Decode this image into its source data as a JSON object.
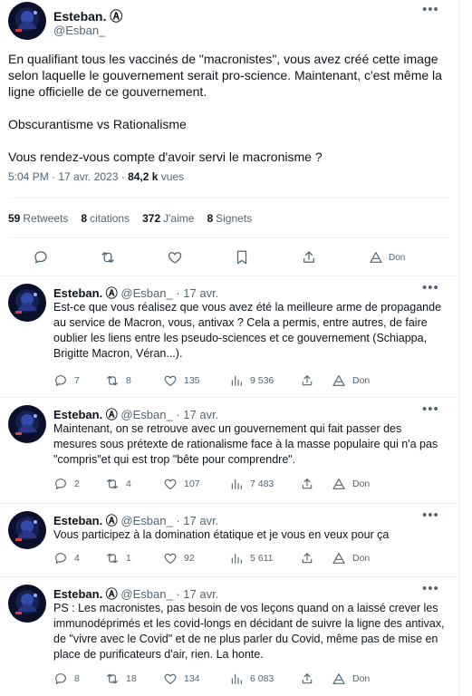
{
  "tweet": {
    "author_name": "Esteban. Ⓐ",
    "author_handle": "@Esban_",
    "body": "En qualifiant tous les vaccinés de \"macronistes\", vous avez créé cette image selon laquelle le gouvernement serait pro-science. Maintenant, c'est même la ligne officielle de ce gouvernement.\n\nObscurantisme vs Rationalisme\n\nVous rendez-vous compte d'avoir servi le macronisme ?",
    "time": "5:04 PM · 17 avr. 2023 · ",
    "views_count": "84,2 k",
    "views_label": " vues",
    "stats": {
      "retweets_count": "59",
      "retweets_label": "Retweets",
      "quotes_count": "8",
      "quotes_label": "citations",
      "likes_count": "372",
      "likes_label": "J'aime",
      "bookmarks_count": "8",
      "bookmarks_label": "Signets"
    },
    "donate_label": "Don"
  },
  "replies": [
    {
      "name": "Esteban. Ⓐ",
      "handle": "@Esban_ · 17 avr.",
      "text": "Est-ce que vous réalisez que vous avez été la meilleure arme de propagande au service de Macron, vous, antivax ? Cela a permis, entre autres, de faire oublier les liens entre les pseudo-sciences et ce gouvernement (Schiappa, Brigitte Macron, Véran...).",
      "replies": "7",
      "retweets": "8",
      "likes": "135",
      "views": "9 536",
      "donate": "Don"
    },
    {
      "name": "Esteban. Ⓐ",
      "handle": "@Esban_ · 17 avr.",
      "text": "Maintenant, on se retrouve avec un gouvernement qui fait passer des mesures sous prétexte de rationalisme face à la masse populaire qui n'a pas \"compris\"et qui est trop \"bête pour comprendre\".",
      "replies": "2",
      "retweets": "4",
      "likes": "107",
      "views": "7 483",
      "donate": "Don"
    },
    {
      "name": "Esteban. Ⓐ",
      "handle": "@Esban_ · 17 avr.",
      "text": "Vous participez à la domination étatique et je vous en veux pour ça",
      "replies": "4",
      "retweets": "1",
      "likes": "92",
      "views": "5 611",
      "donate": "Don"
    },
    {
      "name": "Esteban. Ⓐ",
      "handle": "@Esban_ · 17 avr.",
      "text": "PS : Les macronistes, pas besoin de vos leçons quand on a laissé crever les immunodéprimés et les covid-longs en décidant de suivre la ligne des antivax, de \"vivre avec le Covid\" et de ne plus parler du Covid, même pas de mise en place de purificateurs d'air, rien. La honte.",
      "replies": "8",
      "retweets": "18",
      "likes": "134",
      "views": "6 083",
      "donate": "Don"
    }
  ],
  "colors": {
    "text": "#0f1419",
    "muted": "#536471",
    "border": "#eff3f4",
    "avatar_bg": "#0b0f2a",
    "avatar_glow": "#4a6dff"
  },
  "icons": [
    "more-icon",
    "reply-icon",
    "retweet-icon",
    "like-icon",
    "bookmark-icon",
    "share-icon",
    "views-icon",
    "donate-icon"
  ]
}
